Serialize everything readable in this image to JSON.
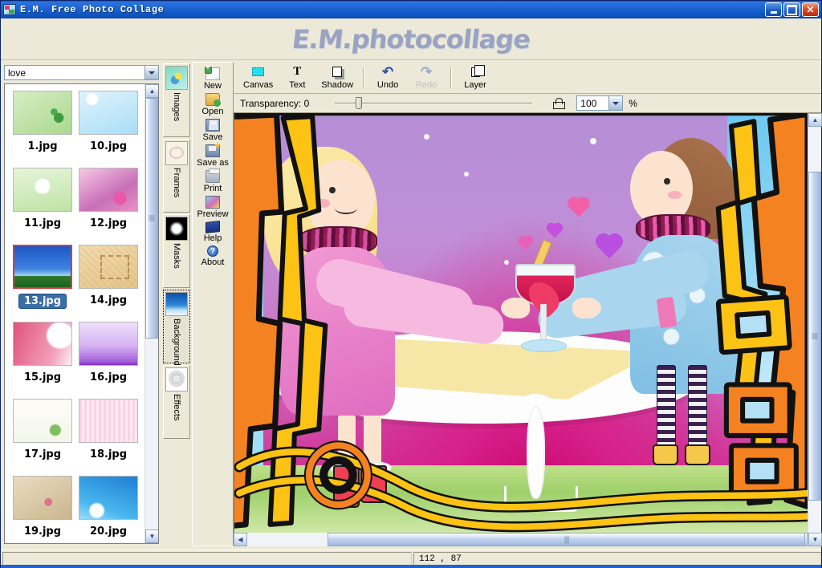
{
  "window": {
    "title": "E.M. Free Photo Collage",
    "app_icon": "app-photo-icon",
    "buttons": {
      "minimize": "minimize",
      "maximize": "restore",
      "close": "close"
    }
  },
  "banner": {
    "text": "E.M.photocollage"
  },
  "sidebar": {
    "category_select": {
      "value": "love",
      "arrow": "chevron-down-icon"
    },
    "thumbnails": [
      {
        "label": "1.jpg",
        "art": "t1",
        "selected": false
      },
      {
        "label": "10.jpg",
        "art": "t10",
        "selected": false
      },
      {
        "label": "11.jpg",
        "art": "t11",
        "selected": false
      },
      {
        "label": "12.jpg",
        "art": "t12",
        "selected": false
      },
      {
        "label": "13.jpg",
        "art": "t13",
        "selected": true
      },
      {
        "label": "14.jpg",
        "art": "t14",
        "selected": false
      },
      {
        "label": "15.jpg",
        "art": "t15",
        "selected": false
      },
      {
        "label": "16.jpg",
        "art": "t16",
        "selected": false
      },
      {
        "label": "17.jpg",
        "art": "t17",
        "selected": false
      },
      {
        "label": "18.jpg",
        "art": "t18",
        "selected": false
      },
      {
        "label": "19.jpg",
        "art": "t19",
        "selected": false
      },
      {
        "label": "20.jpg",
        "art": "t20",
        "selected": false
      }
    ]
  },
  "tabs": [
    {
      "label": "Images",
      "icon": "images-tab-icon",
      "active": false
    },
    {
      "label": "Frames",
      "icon": "frames-tab-icon",
      "active": false
    },
    {
      "label": "Masks",
      "icon": "masks-tab-icon",
      "active": false
    },
    {
      "label": "Backgrounds",
      "icon": "backgrounds-tab-icon",
      "active": true
    },
    {
      "label": "Effects",
      "icon": "effects-tab-icon",
      "active": false
    }
  ],
  "side_toolbar": [
    {
      "label": "New",
      "accel": "N",
      "icon": "new-document-icon"
    },
    {
      "label": "Open",
      "accel": "O",
      "icon": "open-folder-icon"
    },
    {
      "label": "Save",
      "accel": "S",
      "icon": "floppy-disk-icon"
    },
    {
      "label": "Save as",
      "accel": "a",
      "icon": "save-as-icon"
    },
    {
      "label": "Print",
      "accel": "P",
      "icon": "printer-icon"
    },
    {
      "label": "Preview",
      "accel": "P",
      "icon": "preview-image-icon"
    },
    {
      "label": "Help",
      "accel": "H",
      "icon": "help-book-icon"
    },
    {
      "label": "About",
      "accel": "A",
      "icon": "about-info-icon"
    }
  ],
  "toolbar": [
    {
      "label": "Canvas",
      "icon": "canvas-icon",
      "enabled": true
    },
    {
      "label": "Text",
      "icon": "text-icon",
      "enabled": true
    },
    {
      "label": "Shadow",
      "icon": "shadow-icon",
      "enabled": true
    },
    {
      "label": "Undo",
      "icon": "undo-icon",
      "enabled": true
    },
    {
      "label": "Redo",
      "icon": "redo-icon",
      "enabled": false
    },
    {
      "label": "Layer",
      "icon": "layer-icon",
      "enabled": true
    }
  ],
  "transparency": {
    "label": "Transparency: 0",
    "value": 0,
    "lock_icon": "lock-icon",
    "zoom_value": "100",
    "percent_symbol": "%"
  },
  "statusbar": {
    "left": "",
    "coordinates": "112 , 87"
  },
  "canvas": {
    "scroll_h": "horizontal-scrollbar",
    "scroll_v": "vertical-scrollbar",
    "artwork_description": "Two cartoon girls at a white table sharing a heart-shaped cocktail, inside an orange and yellow hand-drawn frame"
  }
}
